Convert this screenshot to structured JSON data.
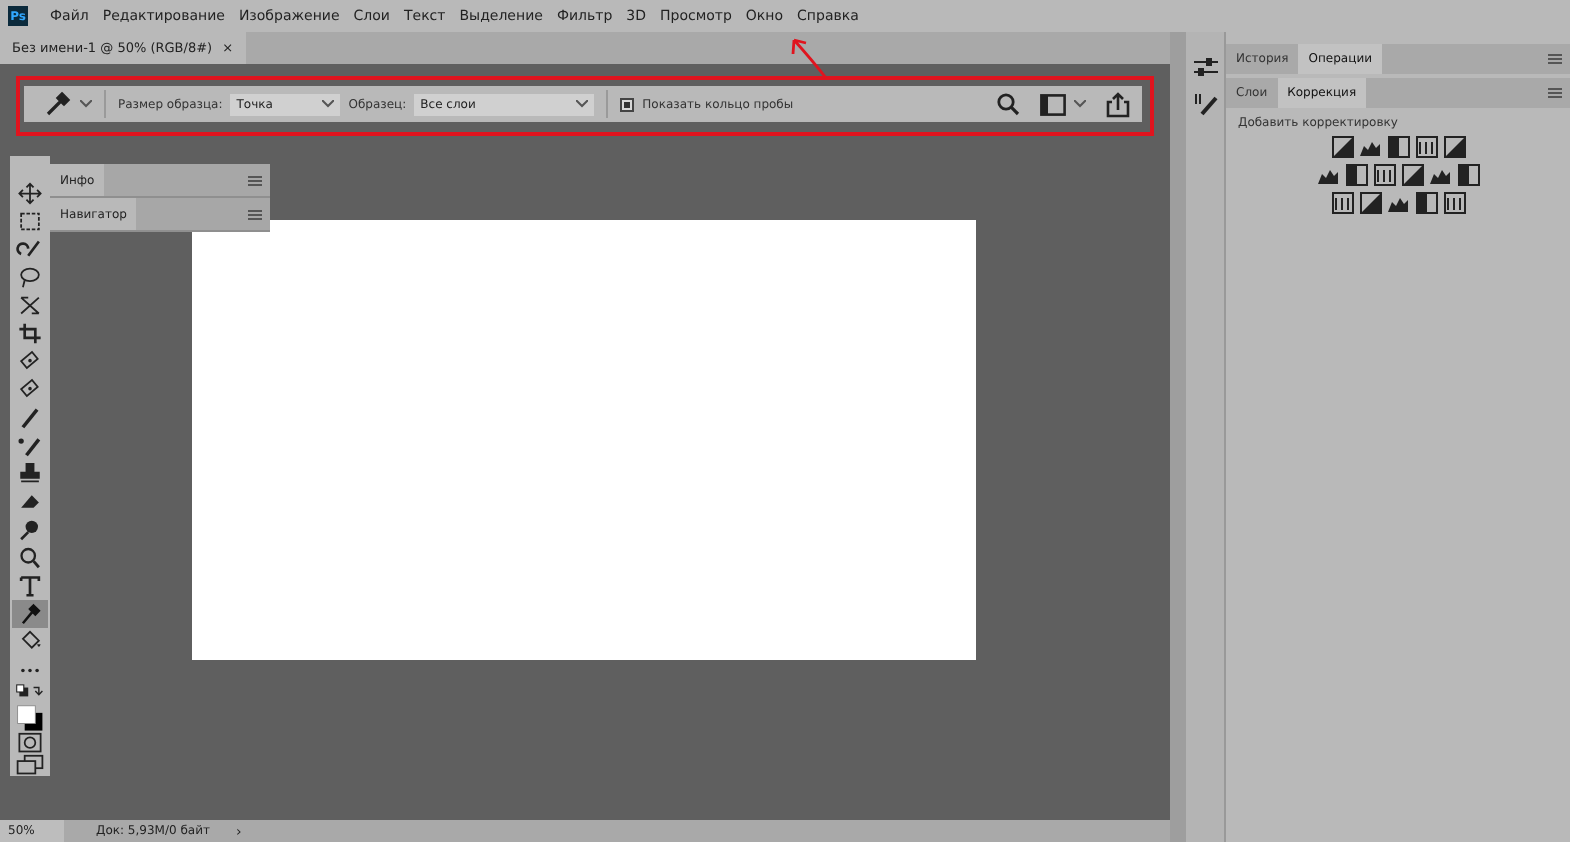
{
  "app_logo": "Ps",
  "menu": [
    "Файл",
    "Редактирование",
    "Изображение",
    "Слои",
    "Текст",
    "Выделение",
    "Фильтр",
    "3D",
    "Просмотр",
    "Окно",
    "Справка"
  ],
  "document_tab": {
    "title": "Без имени-1 @ 50% (RGB/8#)",
    "close": "×"
  },
  "options_bar": {
    "sample_size_label": "Размер образца:",
    "sample_size": "Точка",
    "sample_label": "Образец:",
    "sample": "Все слои",
    "show_ring": {
      "label": "Показать кольцо пробы",
      "checked": true
    }
  },
  "tools": [
    {
      "selected": false
    },
    {
      "selected": false
    },
    {
      "selected": false
    },
    {
      "selected": false
    },
    {
      "selected": false
    },
    {
      "selected": false
    },
    {
      "selected": false
    },
    {
      "selected": false
    },
    {
      "selected": false
    },
    {
      "selected": false
    },
    {
      "selected": false
    },
    {
      "selected": false
    },
    {
      "selected": false
    },
    {
      "selected": false
    },
    {
      "selected": false
    },
    {
      "selected": true
    },
    {
      "selected": false
    },
    {
      "selected": false
    }
  ],
  "floating_panels": [
    {
      "label": "Инфо"
    },
    {
      "label": "Навигатор"
    }
  ],
  "dock_tabs_top": [
    {
      "label": "История",
      "selected": false
    },
    {
      "label": "Операции",
      "selected": true
    }
  ],
  "dock_tabs_bottom": [
    {
      "label": "Слои",
      "selected": false
    },
    {
      "label": "Коррекция",
      "selected": true
    }
  ],
  "adjustments_title": "Добавить корректировку",
  "status_bar": {
    "zoom": "50%",
    "doc_info": "Док: 5,93M/0 байт",
    "arrow": "›"
  }
}
